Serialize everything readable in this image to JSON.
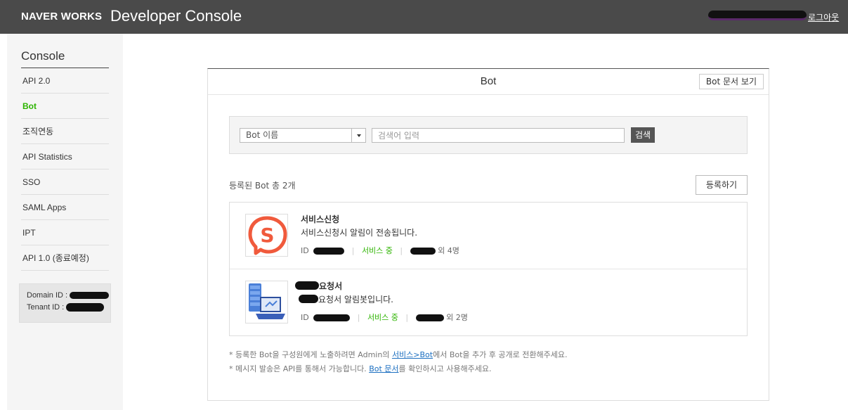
{
  "header": {
    "brand": "NAVER WORKS",
    "product": "Developer Console",
    "logout": "로그아웃"
  },
  "sidebar": {
    "title": "Console",
    "items": [
      {
        "label": "API 2.0"
      },
      {
        "label": "Bot",
        "active": true
      },
      {
        "label": "조직연동"
      },
      {
        "label": "API Statistics"
      },
      {
        "label": "SSO"
      },
      {
        "label": "SAML Apps"
      },
      {
        "label": "IPT"
      },
      {
        "label": "API 1.0 (종료예정)"
      }
    ],
    "domain_label": "Domain ID :",
    "tenant_label": "Tenant ID :"
  },
  "panel": {
    "title": "Bot",
    "doc_button": "Bot 문서 보기"
  },
  "search": {
    "select_value": "Bot 이름",
    "placeholder": "검색어 입력",
    "button": "검색"
  },
  "list": {
    "count_text": "등록된 Bot 총 2개",
    "register_button": "등록하기",
    "bots": [
      {
        "name": "서비스신청",
        "description": "서비스신청시 알림이 전송됩니다.",
        "id_label": "ID",
        "status": "서비스 중",
        "managers_suffix": "외 4명",
        "icon": "s-logo-icon"
      },
      {
        "name": "요청서",
        "description": "요청서 알림봇입니다.",
        "id_label": "ID",
        "status": "서비스 중",
        "managers_suffix": "외 2명",
        "icon": "server-laptop-icon"
      }
    ]
  },
  "notes": {
    "line1_prefix": "* 등록한 Bot을 구성원에게 노출하려면 Admin의 ",
    "line1_link": "서비스>Bot",
    "line1_suffix": "에서 Bot을 추가 후 공개로 전환해주세요.",
    "line2_prefix": "* 메시지 발송은 API를 통해서 가능합니다. ",
    "line2_link": "Bot 문서",
    "line2_suffix": "를 확인하시고 사용해주세요."
  },
  "colors": {
    "header_bg": "#4a4a4a",
    "active_green": "#2db400",
    "link_blue": "#1a6ec0",
    "logo_orange": "#f05a3c"
  }
}
